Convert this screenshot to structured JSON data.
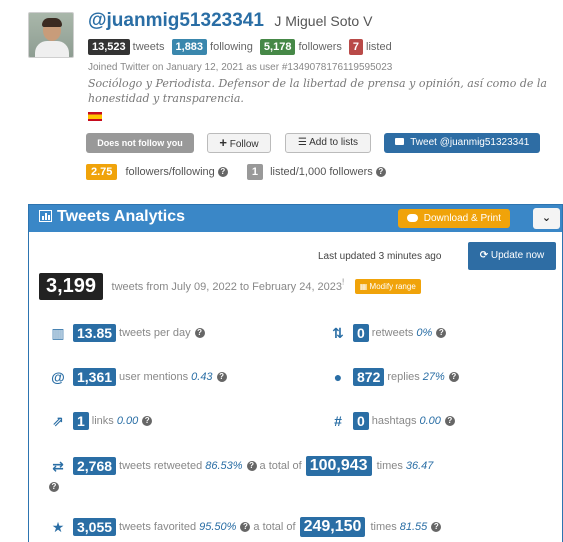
{
  "profile": {
    "handle": "@juanmig51323341",
    "name": "J Miguel Soto V",
    "tweets_count": "13,523",
    "tweets_label": "tweets",
    "following_count": "1,883",
    "following_label": "following",
    "followers_count": "5,178",
    "followers_label": "followers",
    "listed_count": "7",
    "listed_label": "listed",
    "joined": "Joined Twitter on January 12, 2021 as user #1349078176119595023",
    "bio": "Sociólogo y Periodista. Defensor de la libertad de prensa y opinión, así como de la honestidad y transparencia."
  },
  "actions": {
    "not_follow": "Does not follow you",
    "follow": "Follow",
    "add_to_lists": "Add to lists",
    "tweet_to": "Tweet @juanmig51323341"
  },
  "ratios": {
    "followers_following_value": "2.75",
    "followers_following_label": "followers/following",
    "listed_value": "1",
    "listed_label": "listed/1,000 followers"
  },
  "analytics": {
    "title": "Tweets Analytics",
    "download_label": "Download & Print",
    "last_updated": "Last updated 3 minutes ago",
    "update_now": "Update now",
    "tweet_total": "3,199",
    "range_text": "tweets from July 09, 2022 to February 24, 2023",
    "range_mark": "!",
    "modify_range": "Modify range",
    "per_day": {
      "value": "13.85",
      "label": "tweets per day"
    },
    "retweets": {
      "value": "0",
      "label": "retweets",
      "pct": "0%"
    },
    "mentions": {
      "value": "1,361",
      "label": "user mentions",
      "pct": "0.43"
    },
    "replies": {
      "value": "872",
      "label": "replies",
      "pct": "27%"
    },
    "links": {
      "value": "1",
      "label": "links",
      "pct": "0.00"
    },
    "hashtags": {
      "value": "0",
      "label": "hashtags",
      "pct": "0.00"
    },
    "retweeted": {
      "value": "2,768",
      "label": "tweets retweeted",
      "pct": "86.53%",
      "total_label": "a total of",
      "total": "100,943",
      "times_label": "times",
      "times": "36.47"
    },
    "favorited": {
      "value": "3,055",
      "label": "tweets favorited",
      "pct": "95.50%",
      "total_label": "a total of",
      "total": "249,150",
      "times_label": "times",
      "times": "81.55"
    }
  },
  "icons": {
    "help": "question-circle-icon",
    "chart": "bar-chart-icon"
  },
  "colors": {
    "primary_blue": "#2a6ea5",
    "header_blue": "#3a87c7",
    "orange": "#f0a30a"
  }
}
